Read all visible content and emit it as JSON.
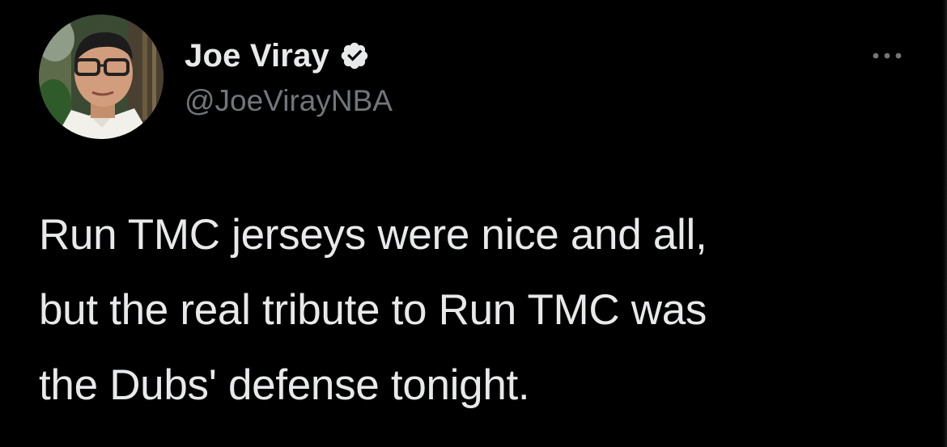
{
  "author": {
    "display_name": "Joe Viray",
    "handle": "@JoeVirayNBA",
    "verified": true,
    "verified_badge_color": "#e7e9ea"
  },
  "icons": {
    "avatar": "profile-photo",
    "verified": "verified-badge-icon",
    "more": "more-horizontal-icon"
  },
  "tweet": {
    "lines": [
      "Run TMC jerseys were nice and all,",
      "but the real tribute to Run TMC was",
      "the Dubs' defense tonight."
    ]
  },
  "colors": {
    "background": "#000000",
    "text": "#e7e9ea",
    "secondary": "#71767b"
  }
}
